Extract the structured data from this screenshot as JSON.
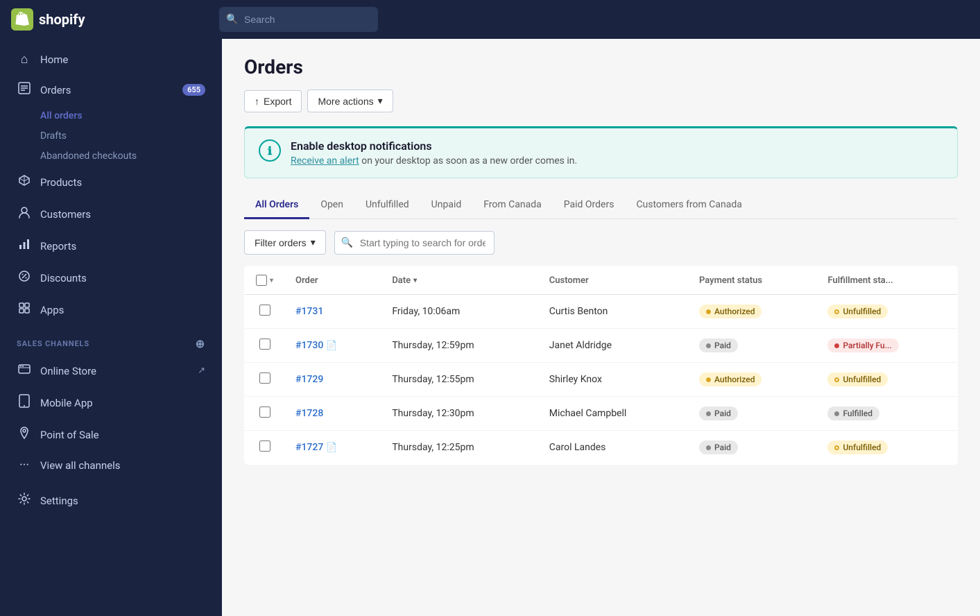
{
  "header": {
    "logo_text": "shopify",
    "search_placeholder": "Search"
  },
  "sidebar": {
    "nav_items": [
      {
        "id": "home",
        "label": "Home",
        "icon": "⌂",
        "badge": null,
        "active": false
      },
      {
        "id": "orders",
        "label": "Orders",
        "icon": "📋",
        "badge": "655",
        "active": false
      },
      {
        "id": "products",
        "label": "Products",
        "icon": "🏷",
        "badge": null,
        "active": false
      },
      {
        "id": "customers",
        "label": "Customers",
        "icon": "👤",
        "badge": null,
        "active": false
      },
      {
        "id": "reports",
        "label": "Reports",
        "icon": "📊",
        "badge": null,
        "active": false
      },
      {
        "id": "discounts",
        "label": "Discounts",
        "icon": "🏷",
        "badge": null,
        "active": false
      },
      {
        "id": "apps",
        "label": "Apps",
        "icon": "⊞",
        "badge": null,
        "active": false
      }
    ],
    "sub_items": [
      {
        "id": "all-orders",
        "label": "All orders",
        "active": true
      },
      {
        "id": "drafts",
        "label": "Drafts",
        "active": false
      },
      {
        "id": "abandoned-checkouts",
        "label": "Abandoned checkouts",
        "active": false
      }
    ],
    "sales_channels_label": "SALES CHANNELS",
    "sales_channels": [
      {
        "id": "online-store",
        "label": "Online Store",
        "icon": "🖥",
        "has_link": true
      },
      {
        "id": "mobile-app",
        "label": "Mobile App",
        "icon": "📱",
        "has_link": false
      },
      {
        "id": "point-of-sale",
        "label": "Point of Sale",
        "icon": "📍",
        "has_link": false
      }
    ],
    "view_all_channels": "View all channels",
    "settings": "Settings"
  },
  "main": {
    "page_title": "Orders",
    "actions": {
      "export_label": "Export",
      "more_actions_label": "More actions"
    },
    "notification": {
      "title": "Enable desktop notifications",
      "body_prefix": "Receive an alert",
      "body_link": "Receive an alert",
      "body_suffix": " on your desktop as soon as a new order comes in."
    },
    "tabs": [
      {
        "id": "all-orders",
        "label": "All Orders",
        "active": true
      },
      {
        "id": "open",
        "label": "Open",
        "active": false
      },
      {
        "id": "unfulfilled",
        "label": "Unfulfilled",
        "active": false
      },
      {
        "id": "unpaid",
        "label": "Unpaid",
        "active": false
      },
      {
        "id": "from-canada",
        "label": "From Canada",
        "active": false
      },
      {
        "id": "paid-orders",
        "label": "Paid Orders",
        "active": false
      },
      {
        "id": "customers-canada",
        "label": "Customers from Canada",
        "active": false
      }
    ],
    "filter_label": "Filter orders",
    "search_placeholder": "Start typing to search for orders...",
    "table": {
      "columns": [
        "Order",
        "Date",
        "Customer",
        "Payment status",
        "Fulfillment sta..."
      ],
      "rows": [
        {
          "order_num": "#1731",
          "has_doc": false,
          "date": "Friday, 10:06am",
          "customer": "Curtis Benton",
          "payment_status": "Authorized",
          "payment_badge_type": "authorized",
          "fulfillment_status": "Unfulfilled",
          "fulfillment_badge_type": "unfulfilled"
        },
        {
          "order_num": "#1730",
          "has_doc": true,
          "date": "Thursday, 12:59pm",
          "customer": "Janet Aldridge",
          "payment_status": "Paid",
          "payment_badge_type": "paid",
          "fulfillment_status": "Partially Fu...",
          "fulfillment_badge_type": "partially"
        },
        {
          "order_num": "#1729",
          "has_doc": false,
          "date": "Thursday, 12:55pm",
          "customer": "Shirley Knox",
          "payment_status": "Authorized",
          "payment_badge_type": "authorized",
          "fulfillment_status": "Unfulfilled",
          "fulfillment_badge_type": "unfulfilled"
        },
        {
          "order_num": "#1728",
          "has_doc": false,
          "date": "Thursday, 12:30pm",
          "customer": "Michael Campbell",
          "payment_status": "Paid",
          "payment_badge_type": "paid",
          "fulfillment_status": "Fulfilled",
          "fulfillment_badge_type": "fulfilled"
        },
        {
          "order_num": "#1727",
          "has_doc": true,
          "date": "Thursday, 12:25pm",
          "customer": "Carol Landes",
          "payment_status": "Paid",
          "payment_badge_type": "paid",
          "fulfillment_status": "Unfulfilled",
          "fulfillment_badge_type": "unfulfilled"
        }
      ]
    }
  }
}
